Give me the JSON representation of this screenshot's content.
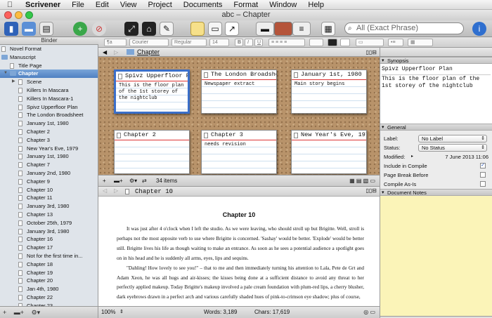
{
  "menubar": {
    "items": [
      "Scrivener",
      "File",
      "Edit",
      "View",
      "Project",
      "Documents",
      "Format",
      "Window",
      "Help"
    ]
  },
  "window": {
    "title": "abc – Chapter"
  },
  "toolbar": {
    "search_placeholder": "All (Exact Phrase)"
  },
  "binder": {
    "header": "Binder",
    "items": [
      {
        "label": "Novel Format",
        "level": 0,
        "kind": "root"
      },
      {
        "label": "Manuscript",
        "level": 0,
        "kind": "folder",
        "open": true
      },
      {
        "label": "Title Page",
        "level": 1,
        "kind": "doc"
      },
      {
        "label": "Chapter",
        "level": 1,
        "kind": "folder",
        "open": true,
        "selected": true
      },
      {
        "label": "Scene",
        "level": 2,
        "kind": "doc",
        "collapsed": true
      },
      {
        "label": "Killers In Mascara",
        "level": 2,
        "kind": "doc"
      },
      {
        "label": "Killers In Mascara-1",
        "level": 2,
        "kind": "doc"
      },
      {
        "label": "Spivz Upperfloor Plan",
        "level": 2,
        "kind": "doc"
      },
      {
        "label": "The London Broadsheet",
        "level": 2,
        "kind": "doc"
      },
      {
        "label": "January 1st, 1980",
        "level": 2,
        "kind": "doc"
      },
      {
        "label": "Chapter 2",
        "level": 2,
        "kind": "doc"
      },
      {
        "label": "Chapter 3",
        "level": 2,
        "kind": "doc"
      },
      {
        "label": "New Year's Eve, 1979",
        "level": 2,
        "kind": "doc"
      },
      {
        "label": "January 1st, 1980",
        "level": 2,
        "kind": "doc"
      },
      {
        "label": "Chapter 7",
        "level": 2,
        "kind": "doc"
      },
      {
        "label": "January 2nd, 1980",
        "level": 2,
        "kind": "doc"
      },
      {
        "label": "Chapter 9",
        "level": 2,
        "kind": "doc"
      },
      {
        "label": "Chapter 10",
        "level": 2,
        "kind": "doc"
      },
      {
        "label": "Chapter 11",
        "level": 2,
        "kind": "doc"
      },
      {
        "label": "January 3rd, 1980",
        "level": 2,
        "kind": "doc"
      },
      {
        "label": "Chapter 13",
        "level": 2,
        "kind": "doc"
      },
      {
        "label": "October 25th, 1979",
        "level": 2,
        "kind": "doc"
      },
      {
        "label": "January 3rd, 1980",
        "level": 2,
        "kind": "doc"
      },
      {
        "label": "Chapter 16",
        "level": 2,
        "kind": "doc"
      },
      {
        "label": "Chapter 17",
        "level": 2,
        "kind": "doc"
      },
      {
        "label": "Not for the first time in...",
        "level": 2,
        "kind": "doc"
      },
      {
        "label": "Chapter 18",
        "level": 2,
        "kind": "doc"
      },
      {
        "label": "Chapter 19",
        "level": 2,
        "kind": "doc"
      },
      {
        "label": "Chapter 20",
        "level": 2,
        "kind": "doc"
      },
      {
        "label": "Jan 4th, 1980",
        "level": 2,
        "kind": "doc"
      },
      {
        "label": "Chapter 22",
        "level": 2,
        "kind": "doc"
      },
      {
        "label": "Chapter 23",
        "level": 2,
        "kind": "doc"
      }
    ]
  },
  "format": {
    "style": "¶a",
    "font": "Courier",
    "weight": "Regular",
    "size": "14"
  },
  "corkboard": {
    "header": "Chapter",
    "cards": [
      {
        "title": "Spivz Upperfloor Plan",
        "synopsis": "This is the floor plan of the 1st storey of the nightclub",
        "selected": true
      },
      {
        "title": "The London Broadsheet",
        "synopsis": "Newspaper extract"
      },
      {
        "title": "January 1st, 1980",
        "synopsis": "Main story begins"
      },
      {
        "title": "Chapter 2",
        "synopsis": ""
      },
      {
        "title": "Chapter 3",
        "synopsis": "needs revision"
      },
      {
        "title": "New Year's Eve, 1979",
        "synopsis": ""
      }
    ],
    "count": "34 items"
  },
  "editor": {
    "header": "Chapter 10",
    "title": "Chapter 10",
    "paragraphs": [
      "It was just after 4 o'clock when I left the studio. As we were leaving, who should stroll up but Brigitte. Well, stroll is perhaps not the most apposite verb to use where Brigitte is concerned. 'Sashay' would be better. 'Explode' would be better still. Brigitte lives his life as though waiting to make an entrance. As soon as he sees a potential audience a spotlight goes on in his head and he is suddenly all arms, eyes, lips and sequins.",
      "\"Dahling! How lovely to see you!\" – that to me and then immediately turning his attention to Lala, Pete de Grt and Adam Xeon, he was all hugs and air-kisses; the kisses being done at a sufficient distance to avoid any threat to her perfectly applied makeup. Today Brigitte's makeup involved a pale cream foundation with plum-red lips, a cherry blusher, dark eyebrows drawn in a perfect arch and various carefully shaded hues of pink-to-crimson eye shadow; plus of course,"
    ],
    "zoom": "100%",
    "words": "Words: 3,189",
    "chars": "Chars: 17,619"
  },
  "inspector": {
    "synopsis_header": "Synopsis",
    "synopsis_title": "Spivz Upperfloor Plan",
    "synopsis_text": "This is the floor plan of the 1st storey of the nightclub",
    "general_header": "General",
    "label_caption": "Label:",
    "label_value": "No Label",
    "status_caption": "Status:",
    "status_value": "No Status",
    "modified_caption": "Modified:",
    "modified_value": "7 June 2013 11:06",
    "include_compile": "Include in Compile",
    "page_break": "Page Break Before",
    "compile_as_is": "Compile As-Is",
    "notes_header": "Document Notes"
  }
}
